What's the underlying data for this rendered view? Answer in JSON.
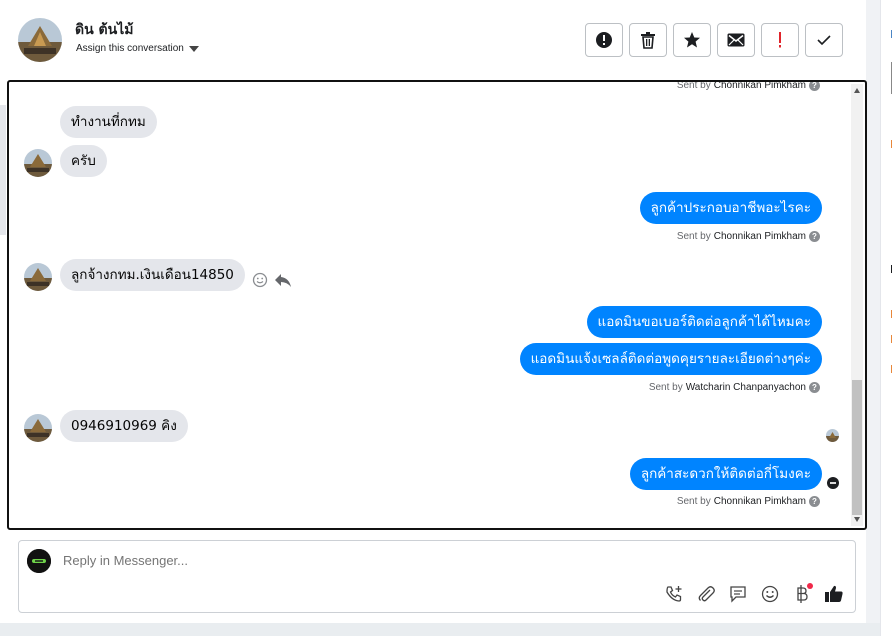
{
  "header": {
    "contact_name": "ดิน ต้นไม้",
    "assign_label": "Assign this conversation",
    "actions": [
      {
        "icon": "alert-circle-icon",
        "name": "mark-spam-button"
      },
      {
        "icon": "trash-icon",
        "name": "delete-button"
      },
      {
        "icon": "star-icon",
        "name": "star-button"
      },
      {
        "icon": "envelope-icon",
        "name": "mark-unread-button"
      },
      {
        "icon": "exclamation-icon",
        "name": "follow-up-button"
      },
      {
        "icon": "checkmark-icon",
        "name": "done-button"
      }
    ]
  },
  "messages": {
    "top_sent_by": {
      "prefix": "Sent by",
      "who": "Chonnikan Pimkham"
    },
    "m1": "ทำงานที่กทม",
    "m2": "ครับ",
    "m3": "ลูกค้าประกอบอาชีพอะไรคะ",
    "m3_sent_by": {
      "prefix": "Sent by",
      "who": "Chonnikan Pimkham"
    },
    "m4": "ลูกจ้างกทม.เงินเดือน14850",
    "m5": "แอดมินขอเบอร์ติดต่อลูกค้าได้ไหมคะ",
    "m6": "แอดมินแจ้งเซลล์ติดต่อพูดคุยรายละเอียดต่างๆค่ะ",
    "m6_sent_by": {
      "prefix": "Sent by",
      "who": "Watcharin Chanpanyachon"
    },
    "m7": "0946910969 คิง",
    "m8": "ลูกค้าสะดวกให้ติดต่อกี่โมงคะ",
    "m8_sent_by": {
      "prefix": "Sent by",
      "who": "Chonnikan Pimkham"
    },
    "qmark": "?"
  },
  "composer": {
    "placeholder": "Reply in Messenger...",
    "tools": [
      "phone-add-icon",
      "paperclip-icon",
      "saved-reply-icon",
      "emoji-icon",
      "baht-payment-icon",
      "thumbs-up-icon"
    ]
  },
  "colors": {
    "outgoing_bubble": "#0084ff",
    "incoming_bubble": "#e4e6eb",
    "notification_dot": "#f02849"
  }
}
